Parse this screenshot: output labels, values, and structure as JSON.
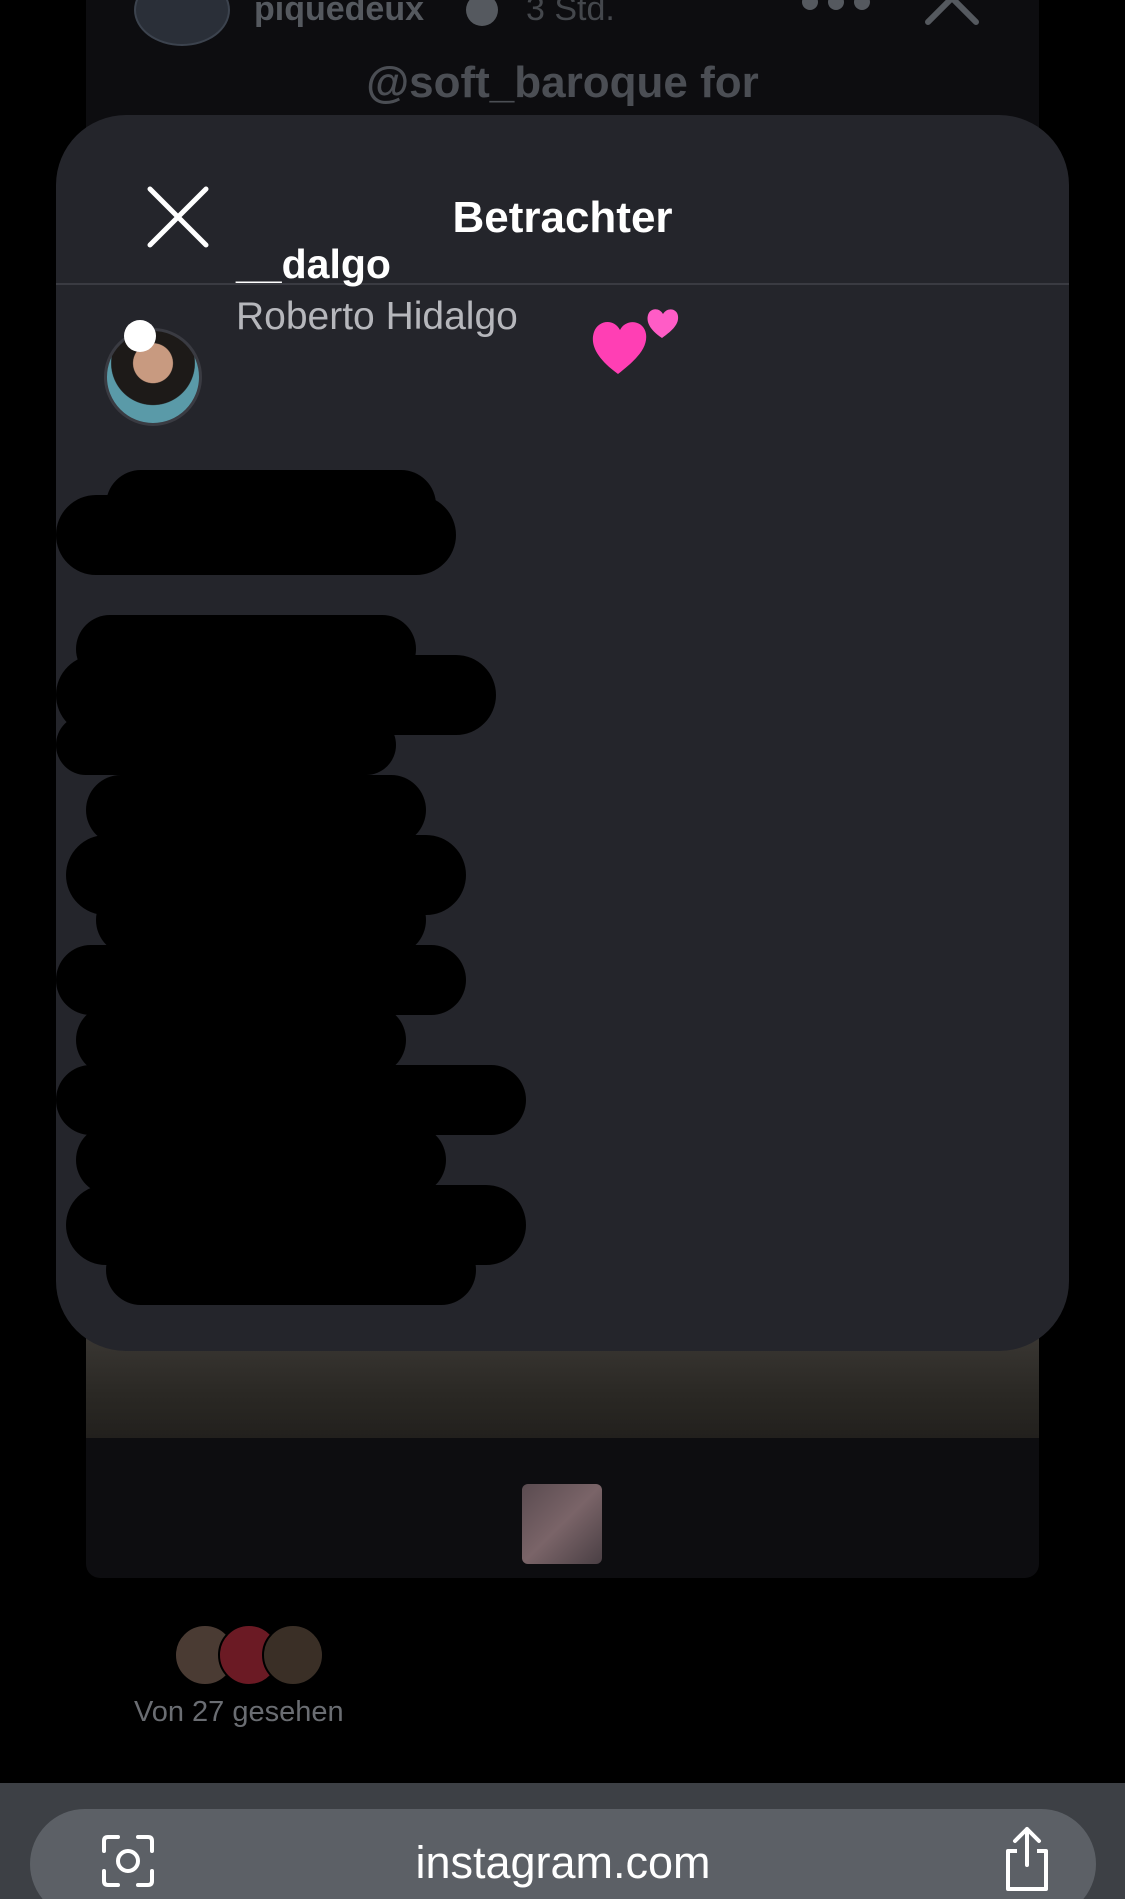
{
  "story": {
    "username": "piquedeux",
    "time": "3 Std.",
    "caption": "@soft_baroque for"
  },
  "sheet": {
    "title": "Betrachter",
    "viewers": [
      {
        "username": "__dalgo",
        "full_name": "Roberto Hidalgo",
        "reaction_icon": "two-hearts-icon"
      }
    ]
  },
  "seen": {
    "count_label": "Von 27 gesehen",
    "avatar_count": 3
  },
  "browser": {
    "url": "instagram.com"
  },
  "colors": {
    "sheet_bg": "#24252b",
    "page_bg": "#000000",
    "hearts": "#ff3fb4"
  }
}
